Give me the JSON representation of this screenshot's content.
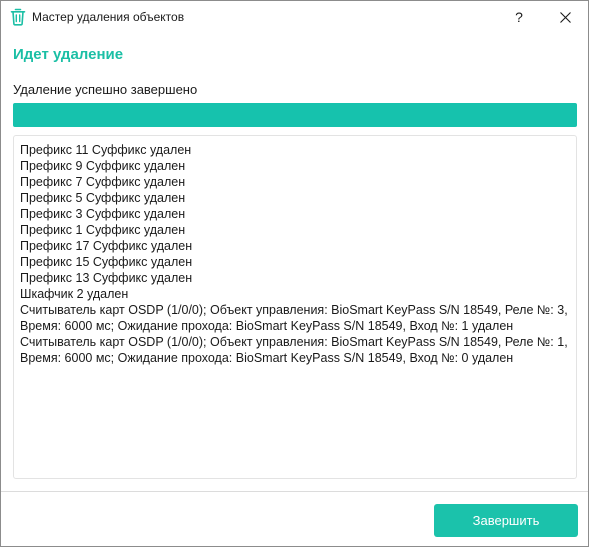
{
  "window": {
    "title": "Мастер удаления объектов",
    "help_label": "?",
    "title_icon": "trash-icon",
    "accent_color": "#1bbfa5"
  },
  "content": {
    "heading": "Идет удаление",
    "status": "Удаление успешно завершено",
    "progress_percent": 100,
    "log_lines": [
      "Префикс 11 Суффикс удален",
      "Префикс 9 Суффикс удален",
      "Префикс 7 Суффикс удален",
      "Префикс 5 Суффикс удален",
      "Префикс 3 Суффикс удален",
      "Префикс 1 Суффикс удален",
      "Префикс 17 Суффикс удален",
      "Префикс 15 Суффикс удален",
      "Префикс 13 Суффикс удален",
      "Шкафчик 2 удален",
      "Считыватель карт OSDP (1/0/0); Объект управления: BioSmart KeyPass S/N 18549, Реле №: 3, Время: 6000 мс; Ожидание прохода: BioSmart KeyPass S/N 18549, Вход №: 1 удален",
      "Считыватель карт OSDP (1/0/0); Объект управления: BioSmart KeyPass S/N 18549, Реле №: 1, Время: 6000 мс; Ожидание прохода: BioSmart KeyPass S/N 18549, Вход №: 0 удален"
    ]
  },
  "footer": {
    "finish_label": "Завершить"
  }
}
